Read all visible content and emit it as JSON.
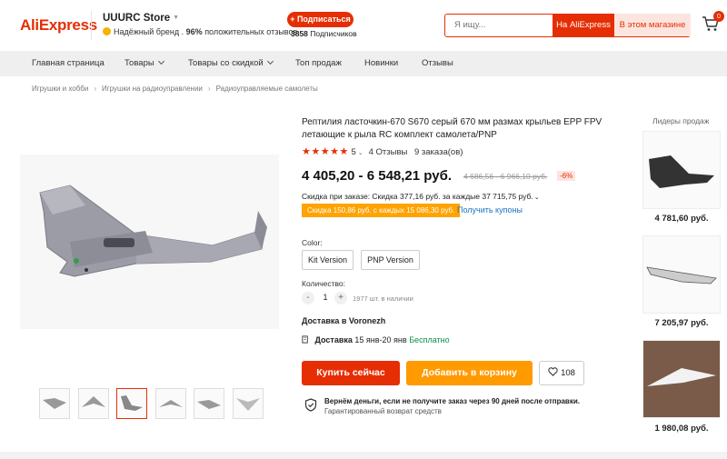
{
  "header": {
    "logo": "AliExpress",
    "store_name": "UUURC Store",
    "brand_text": "Надёжный бренд",
    "positive_percent": "96%",
    "positive_text": "положительных отзывов",
    "subscribe_label": "+ Подписаться",
    "subscribers_count": "3858",
    "subscribers_label": "Подписчиков",
    "search_placeholder": "Я ищу...",
    "search_btn_ali": "На AliExpress",
    "search_btn_store": "В этом магазине",
    "cart_count": "0"
  },
  "nav": {
    "items": [
      "Главная страница",
      "Товары",
      "Товары со скидкой",
      "Топ продаж",
      "Новинки",
      "Отзывы"
    ]
  },
  "breadcrumb": [
    "Игрушки и хобби",
    "Игрушки на радиоуправлении",
    "Радиоуправляемые самолеты"
  ],
  "product": {
    "title": "Рептилия ласточкин-670 S670 серый 670 мм размах крыльев EPP FPV летающие к рыла RC комплект самолета/PNP",
    "rating": "5",
    "reviews": "4 Отзывы",
    "orders": "9 заказа(ов)",
    "price": "4 405,20 - 6 548,21 руб.",
    "old_price": "4 686,56 - 6 966,10 руб.",
    "discount": "-6%",
    "discount_line": "Скидка при заказе: Скидка 377,16 руб. за каждые 37 715,75 руб.",
    "coupon": "Скидка 150,86 руб. с каждых 15 086,30 руб.",
    "coupon_link": "Получить купоны",
    "color_label": "Color:",
    "options": [
      "Kit Version",
      "PNP Version"
    ],
    "quantity_label": "Количество:",
    "qty_minus": "-",
    "qty_plus": "+",
    "quantity": "1",
    "available": "1977 шт. в наличии",
    "delivery_to": "Доставка в Voronezh",
    "delivery_label": "Доставка",
    "delivery_dates": "15 янв-20 янв",
    "delivery_free": "Бесплатно",
    "buy_label": "Купить сейчас",
    "cart_label": "Добавить в корзину",
    "wish_count": "108",
    "guarantee_title": "Вернём деньги, если не получите заказ через 90 дней после отправки.",
    "guarantee_sub": "Гарантированный возврат средств"
  },
  "sidebar": {
    "title": "Лидеры продаж",
    "prices": [
      "4 781,60 руб.",
      "7 205,97 руб.",
      "1 980,08 руб."
    ]
  },
  "colors": {
    "accent": "#e62e04",
    "orange": "#ff9a00",
    "link": "#1a73c2",
    "free": "#0a8f4b"
  }
}
